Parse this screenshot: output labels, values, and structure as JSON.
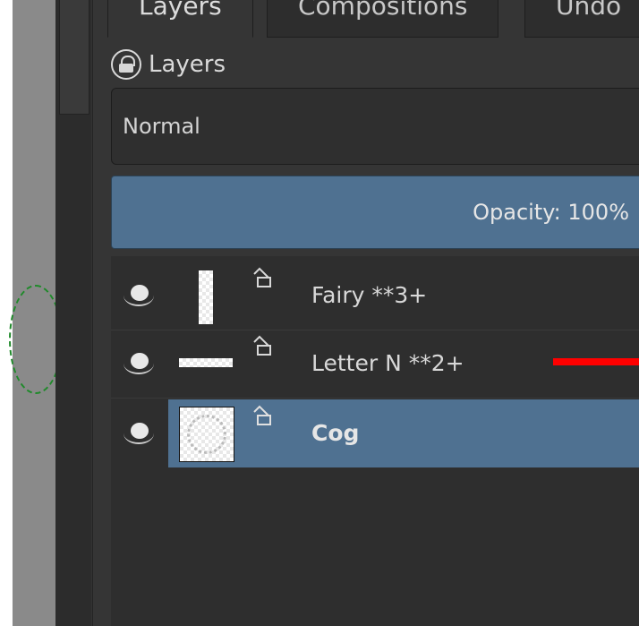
{
  "tabs": [
    {
      "label": "Layers",
      "active": true
    },
    {
      "label": "Compositions",
      "active": false
    },
    {
      "label": "Undo",
      "active": false
    }
  ],
  "panel": {
    "title": "Layers",
    "blend_mode": "Normal",
    "opacity_text": "Opacity:  100%"
  },
  "layers": [
    {
      "name": "Fairy **3+",
      "visible": true,
      "selected": false
    },
    {
      "name": "Letter N **2+",
      "visible": true,
      "selected": false
    },
    {
      "name": "Cog",
      "visible": true,
      "selected": true
    }
  ],
  "colors": {
    "selection": "#4f7191",
    "panel_bg": "#353535",
    "marker_red": "#ff0000",
    "canvas_outline_green": "#1f8a2a"
  }
}
